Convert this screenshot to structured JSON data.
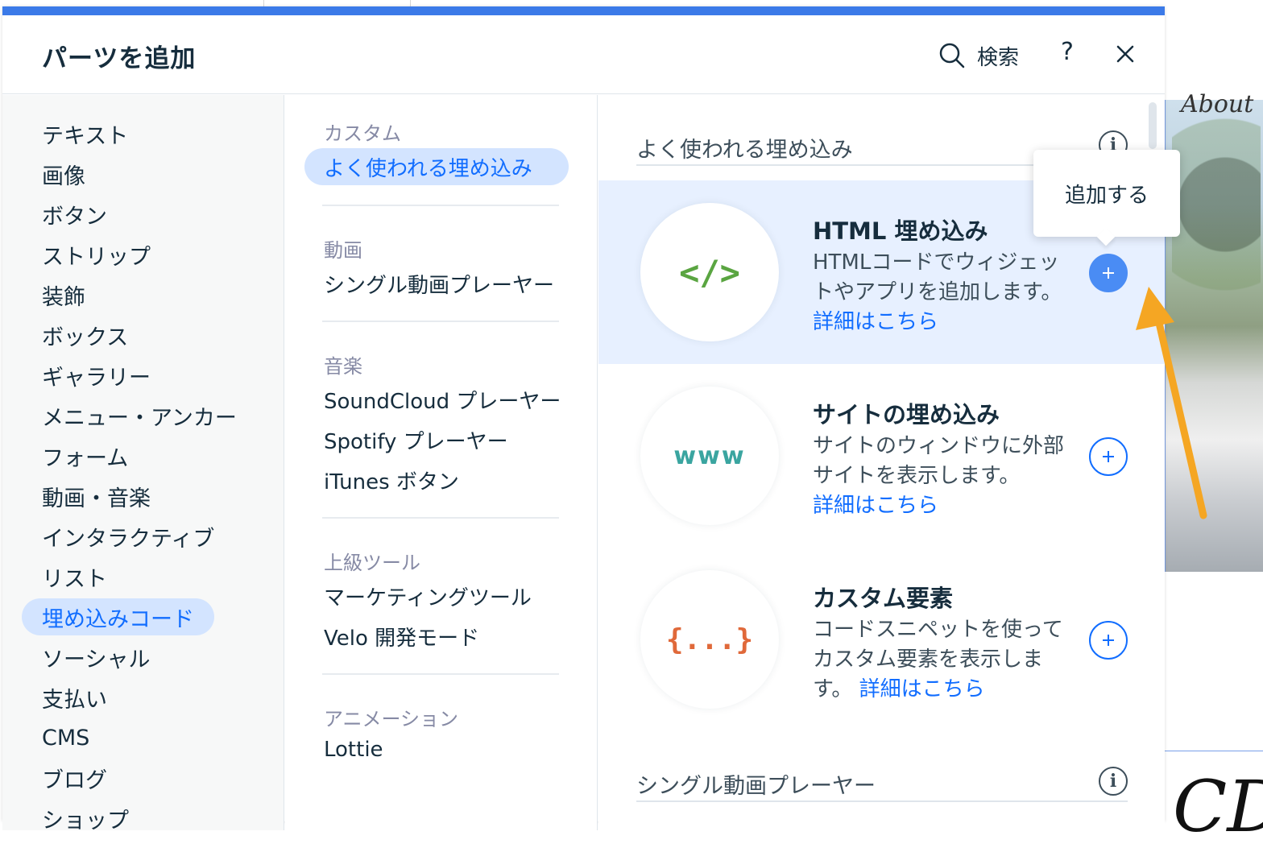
{
  "panel": {
    "title": "パーツを追加",
    "search_label": "検索",
    "help_label": "?"
  },
  "categories": [
    {
      "label": "テキスト"
    },
    {
      "label": "画像"
    },
    {
      "label": "ボタン"
    },
    {
      "label": "ストリップ"
    },
    {
      "label": "装飾"
    },
    {
      "label": "ボックス"
    },
    {
      "label": "ギャラリー"
    },
    {
      "label": "メニュー・アンカー"
    },
    {
      "label": "フォーム"
    },
    {
      "label": "動画・音楽"
    },
    {
      "label": "インタラクティブ"
    },
    {
      "label": "リスト"
    },
    {
      "label": "埋め込みコード",
      "selected": true
    },
    {
      "label": "ソーシャル"
    },
    {
      "label": "支払い"
    },
    {
      "label": "CMS"
    },
    {
      "label": "ブログ"
    },
    {
      "label": "ショップ"
    }
  ],
  "subsections": [
    {
      "title": "カスタム",
      "items": [
        "よく使われる埋め込み"
      ]
    },
    {
      "title": "動画",
      "items": [
        "シングル動画プレーヤー"
      ]
    },
    {
      "title": "音楽",
      "items": [
        "SoundCloud プレーヤー",
        "Spotify プレーヤー",
        "iTunes ボタン"
      ]
    },
    {
      "title": "上級ツール",
      "items": [
        "マーケティングツール",
        "Velo 開発モード"
      ]
    },
    {
      "title": "アニメーション",
      "items": [
        "Lottie"
      ]
    }
  ],
  "content": {
    "section1_title": "よく使われる埋め込み",
    "section2_title": "シングル動画プレーヤー",
    "info_label": "i",
    "cards": [
      {
        "name": "HTML 埋め込み",
        "desc": "HTMLコードでウィジェットやアプリを追加します。",
        "link": "詳細はこちら",
        "icon_text": "</>",
        "icon_color": "#5aa541"
      },
      {
        "name": "サイトの埋め込み",
        "desc": "サイトのウィンドウに外部サイトを表示します。",
        "link": "詳細はこちら",
        "icon_text": "www",
        "icon_color": "#3aa5a0"
      },
      {
        "name": "カスタム要素",
        "desc": "コードスニペットを使ってカスタム要素を表示します。",
        "link": "詳細はこちら",
        "icon_text": "{...}",
        "icon_color": "#e0693a"
      }
    ]
  },
  "tooltip": {
    "label": "追加する"
  },
  "background": {
    "heading_fragment": "About",
    "letter_fragment": "CD"
  },
  "colors": {
    "accent": "#116dff",
    "top_bar": "#3b7ae8",
    "selected_bg": "#d3e4ff",
    "hover_bg": "#e7f0ff",
    "arrow": "#f5a623"
  }
}
